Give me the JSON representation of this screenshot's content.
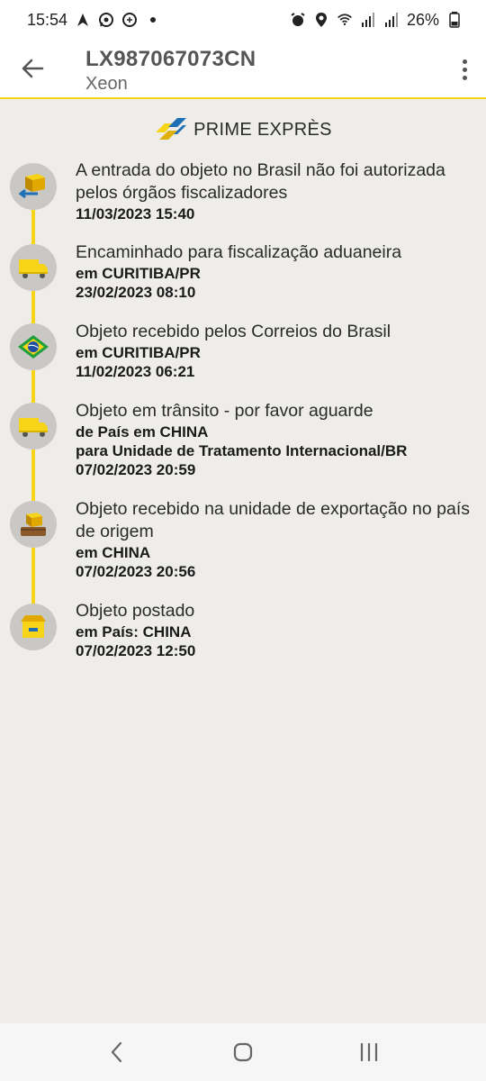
{
  "status_bar": {
    "time": "15:54",
    "battery": "26%",
    "left_icons": [
      "navigation-icon",
      "whatsapp-icon",
      "chat-icon",
      "dot-icon"
    ],
    "right_icons": [
      "alarm-icon",
      "location-icon",
      "wifi-icon",
      "signal-icon",
      "signal-icon",
      "battery-icon"
    ]
  },
  "app_bar": {
    "title": "LX987067073CN",
    "subtitle": "Xeon"
  },
  "brand": {
    "name": "PRIME EXPRÈS"
  },
  "events": [
    {
      "icon": "brazil-customs-icon",
      "title": "A entrada do objeto no Brasil não foi autorizada pelos órgãos fiscalizadores",
      "lines": [
        "11/03/2023 15:40"
      ]
    },
    {
      "icon": "delivery-truck-icon",
      "title": "Encaminhado para fiscalização aduaneira",
      "lines": [
        "em CURITIBA/PR",
        "23/02/2023 08:10"
      ]
    },
    {
      "icon": "brazil-flag-icon",
      "title": "Objeto recebido pelos Correios do Brasil",
      "lines": [
        "em CURITIBA/PR",
        "11/02/2023 06:21"
      ]
    },
    {
      "icon": "delivery-truck-icon",
      "title": "Objeto em trânsito - por favor aguarde",
      "lines": [
        "de País em CHINA",
        "para Unidade de Tratamento Internacional/BR",
        "07/02/2023 20:59"
      ]
    },
    {
      "icon": "export-package-icon",
      "title": "Objeto recebido na unidade de exportação no país de origem",
      "lines": [
        "em CHINA",
        "07/02/2023 20:56"
      ]
    },
    {
      "icon": "post-office-icon",
      "title": "Objeto postado",
      "lines": [
        "em País: CHINA",
        "07/02/2023 12:50"
      ]
    }
  ],
  "colors": {
    "accent_yellow": "#f7d417",
    "icon_bg": "#c9c8c5",
    "correios_blue": "#1f6fb5"
  }
}
